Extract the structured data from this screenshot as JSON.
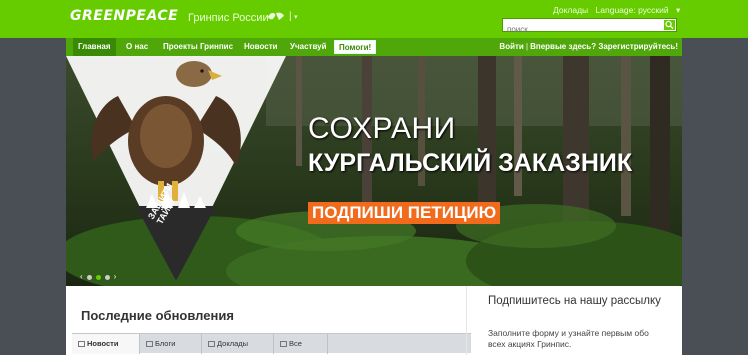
{
  "header": {
    "logo": "GREENPEACE",
    "site_name": "Гринпис России",
    "lang_sep": "|",
    "lang_dropdown": "▾",
    "top_links": [
      "Доклады",
      "Language: русский",
      "▾"
    ],
    "search_placeholder": "поиск",
    "icons": {
      "globe": "globe-icon",
      "search": "search-icon"
    }
  },
  "nav": {
    "items": [
      "Главная",
      "О нас",
      "Проекты Гринпис",
      "Новости",
      "Участвуй"
    ],
    "help": "Помоги!",
    "login": "Войти",
    "sep": "|",
    "register": "Впервые здесь? Зарегистрируйтесь!"
  },
  "banner": {
    "headline1": "СОХРАНИ",
    "headline2": "КУРГАЛЬСКИЙ ЗАКАЗНИК",
    "cta": "ПОДПИШИ ПЕТИЦИЮ",
    "badge": "ЗАЩИТИ\nТАЙГУ",
    "slider": {
      "prev": "‹",
      "next": "›",
      "slides": 3,
      "active": 2
    }
  },
  "content": {
    "news_title": "Последние обновления",
    "tabs": [
      "Новости",
      "Блоги",
      "Доклады",
      "Все"
    ],
    "subscribe_title": "Подпишитесь на нашу рассылку",
    "subscribe_text": "Заполните форму и узнайте первым обо всех акциях Гринпис."
  },
  "colors": {
    "green": "#66cc00",
    "nav_green": "#4fa70a",
    "orange": "#f26a1b"
  }
}
